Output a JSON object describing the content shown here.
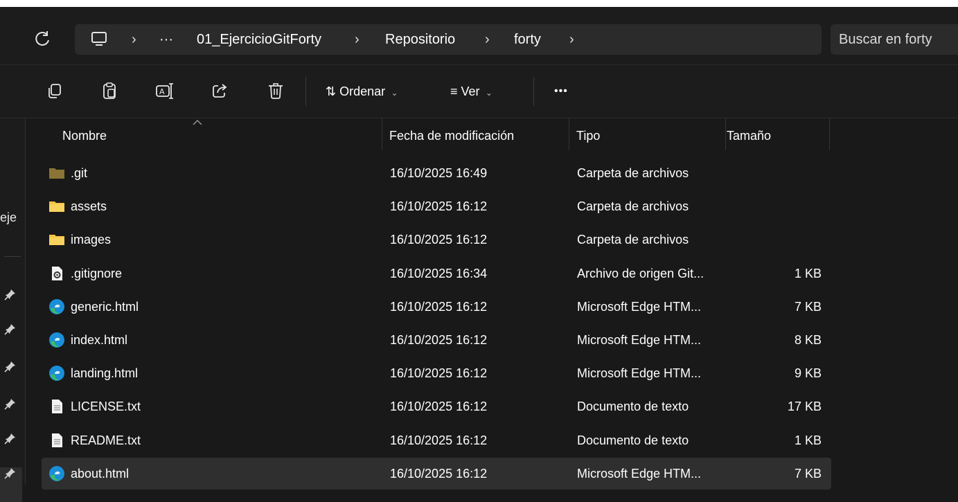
{
  "address_bar": {
    "breadcrumb": [
      "01_EjercicioGitForty",
      "Repositorio",
      "forty"
    ],
    "overflow": "···",
    "search_placeholder": "Buscar en forty"
  },
  "toolbar": {
    "sort_label": "Ordenar",
    "view_label": "Ver",
    "more_label": "•••"
  },
  "nav_pane": {
    "partial_label": "eje"
  },
  "columns": {
    "name": "Nombre",
    "date": "Fecha de modificación",
    "type": "Tipo",
    "size": "Tamaño"
  },
  "files": [
    {
      "name": ".git",
      "date": "16/10/2025 16:49",
      "type": "Carpeta de archivos",
      "size": "",
      "icon": "folder-git-icon"
    },
    {
      "name": "assets",
      "date": "16/10/2025 16:12",
      "type": "Carpeta de archivos",
      "size": "",
      "icon": "folder-icon"
    },
    {
      "name": "images",
      "date": "16/10/2025 16:12",
      "type": "Carpeta de archivos",
      "size": "",
      "icon": "folder-icon"
    },
    {
      "name": ".gitignore",
      "date": "16/10/2025 16:34",
      "type": "Archivo de origen Git...",
      "size": "1 KB",
      "icon": "settings-file-icon"
    },
    {
      "name": "generic.html",
      "date": "16/10/2025 16:12",
      "type": "Microsoft Edge HTM...",
      "size": "7 KB",
      "icon": "edge-icon"
    },
    {
      "name": "index.html",
      "date": "16/10/2025 16:12",
      "type": "Microsoft Edge HTM...",
      "size": "8 KB",
      "icon": "edge-icon"
    },
    {
      "name": "landing.html",
      "date": "16/10/2025 16:12",
      "type": "Microsoft Edge HTM...",
      "size": "9 KB",
      "icon": "edge-icon"
    },
    {
      "name": "LICENSE.txt",
      "date": "16/10/2025 16:12",
      "type": "Documento de texto",
      "size": "17 KB",
      "icon": "text-file-icon"
    },
    {
      "name": "README.txt",
      "date": "16/10/2025 16:12",
      "type": "Documento de texto",
      "size": "1 KB",
      "icon": "text-file-icon"
    },
    {
      "name": "about.html",
      "date": "16/10/2025 16:12",
      "type": "Microsoft Edge HTM...",
      "size": "7 KB",
      "icon": "edge-icon"
    }
  ],
  "selected_file": "about.html",
  "colors": {
    "background": "#191919",
    "chrome": "#1c1c1c",
    "field": "#2b2b2b",
    "selection": "#2f2f2f",
    "folder": "#f6c445",
    "edge_blue": "#1a8fd8",
    "edge_green": "#3fbf5a"
  }
}
